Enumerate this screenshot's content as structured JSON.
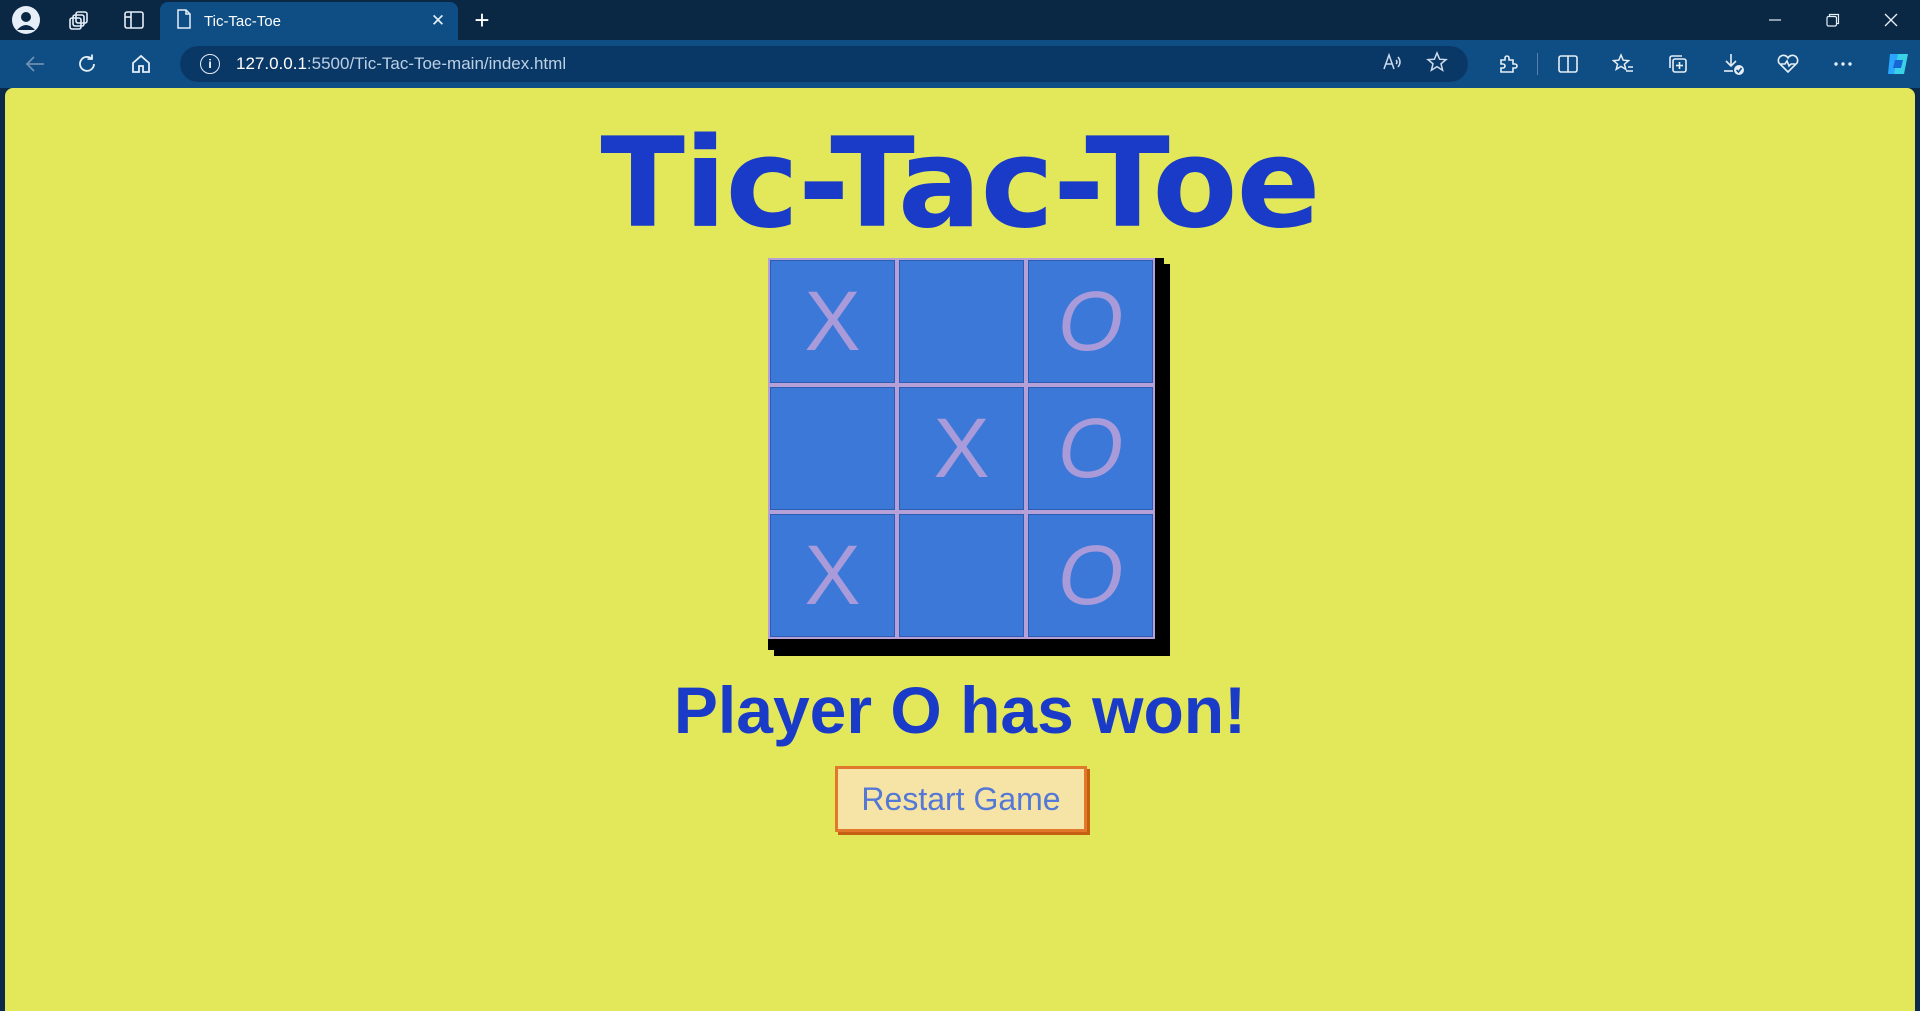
{
  "browser": {
    "tab_title": "Tic-Tac-Toe",
    "url_host": "127.0.0.1",
    "url_path": ":5500/Tic-Tac-Toe-main/index.html",
    "new_tab": "+",
    "tab_close": "✕"
  },
  "page": {
    "heading": "Tic-Tac-Toe",
    "status": "Player O has won!",
    "restart_label": "Restart Game"
  },
  "board": {
    "cells": [
      "X",
      "",
      "O",
      "",
      "X",
      "O",
      "X",
      "",
      "O"
    ]
  },
  "colors": {
    "page_background": "#e3e85b",
    "heading": "#1a3bc7",
    "cell": "#3c78d8",
    "mark": "#a99bd9",
    "button_background": "#f6e3a6",
    "button_border": "#e07a2a"
  },
  "icons": {
    "profile": "profile-icon",
    "workspaces": "workspaces-icon",
    "tab_actions": "tab-actions-icon",
    "document": "document-icon",
    "back": "back-icon",
    "refresh": "refresh-icon",
    "home": "home-icon",
    "site_info": "info-icon",
    "read_aloud": "read-aloud-icon",
    "favorite": "star-icon",
    "extensions": "extensions-icon",
    "split_screen": "split-screen-icon",
    "favorites": "favorites-icon",
    "collections": "collections-icon",
    "downloads": "downloads-icon",
    "performance": "performance-icon",
    "more": "more-icon",
    "copilot": "copilot-icon"
  }
}
